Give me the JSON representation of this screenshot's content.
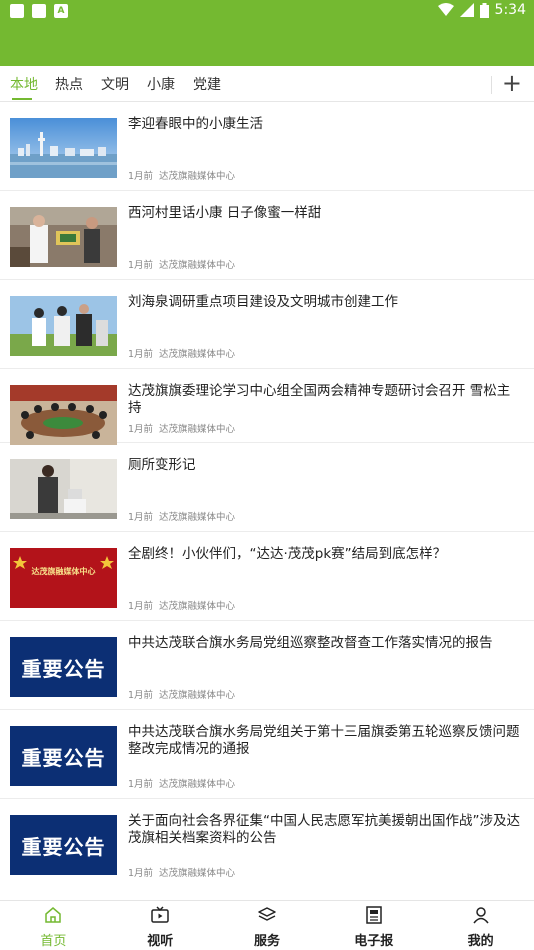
{
  "status": {
    "time": "5:34"
  },
  "tabs": [
    "本地",
    "热点",
    "文明",
    "小康",
    "党建"
  ],
  "tabs_active": "本地",
  "tabs_add_icon": "plus-icon",
  "articles": [
    {
      "title": "李迎春眼中的小康生活",
      "time": "1月前",
      "source": "达茂旗融媒体中心"
    },
    {
      "title": "西河村里话小康  日子像蜜一样甜",
      "time": "1月前",
      "source": "达茂旗融媒体中心"
    },
    {
      "title": "刘海泉调研重点项目建设及文明城市创建工作",
      "time": "1月前",
      "source": "达茂旗融媒体中心"
    },
    {
      "title": "达茂旗旗委理论学习中心组全国两会精神专题研讨会召开  雪松主持",
      "time": "1月前",
      "source": "达茂旗融媒体中心"
    },
    {
      "title": "厕所变形记",
      "time": "1月前",
      "source": "达茂旗融媒体中心"
    },
    {
      "title": "全剧终！小伙伴们，“达达·茂茂pk赛”结局到底怎样？",
      "time": "1月前",
      "source": "达茂旗融媒体中心"
    },
    {
      "title": "中共达茂联合旗水务局党组巡察整改督查工作落实情况的报告",
      "time": "1月前",
      "source": "达茂旗融媒体中心"
    },
    {
      "title": "中共达茂联合旗水务局党组关于第十三届旗委第五轮巡察反馈问题整改完成情况的通报",
      "time": "1月前",
      "source": "达茂旗融媒体中心"
    },
    {
      "title": "关于面向社会各界征集“中国人民志愿军抗美援朝出国作战”涉及达茂旗相关档案资料的公告",
      "time": "1月前",
      "source": "达茂旗融媒体中心"
    }
  ],
  "notice_text": "重要公告",
  "banner_text": "达茂旗融媒体中心",
  "nav": [
    "首页",
    "视听",
    "服务",
    "电子报",
    "我的"
  ],
  "colors": {
    "accent": "#74b931",
    "notice_bg": "#0c2f74"
  }
}
